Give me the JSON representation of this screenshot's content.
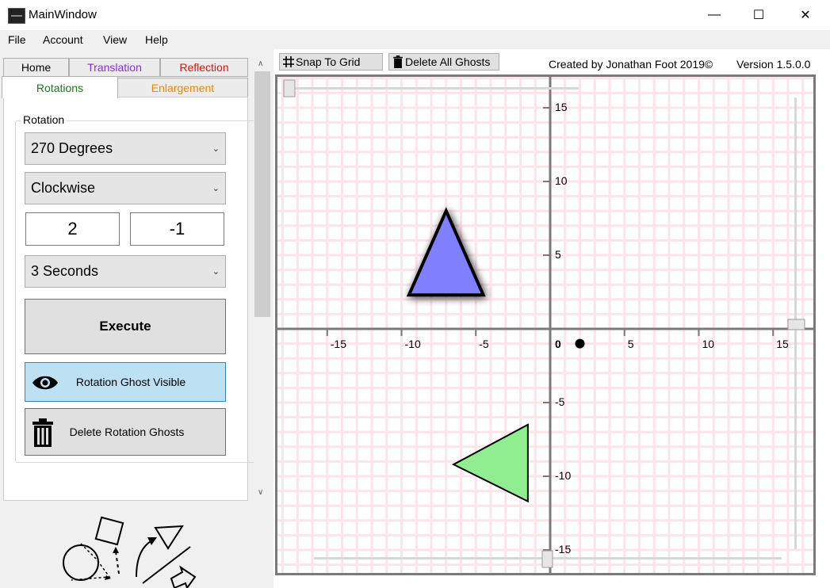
{
  "window": {
    "title": "MainWindow",
    "minimize_glyph": "—",
    "maximize_glyph": "☐",
    "close_glyph": "✕"
  },
  "menu": {
    "items": [
      "File",
      "Account",
      "View",
      "Help"
    ]
  },
  "tabs": {
    "home": {
      "label": "Home",
      "color": "#000000"
    },
    "translation": {
      "label": "Translation",
      "color": "#8a2be2"
    },
    "reflection": {
      "label": "Reflection",
      "color": "#e01010"
    },
    "rotations": {
      "label": "Rotations",
      "color": "#1a7a1a"
    },
    "enlargement": {
      "label": "Enlargement",
      "color": "#e88a00"
    }
  },
  "rotation": {
    "group_label": "Rotation",
    "angle": "270 Degrees",
    "direction": "Clockwise",
    "centre_x": "2",
    "centre_y": "-1",
    "duration": "3 Seconds",
    "execute_label": "Execute",
    "ghost_visible_label": "Rotation Ghost Visible",
    "delete_ghosts_label": "Delete Rotation Ghosts",
    "ghost_icon": "eye-icon",
    "delete_icon": "trash-icon"
  },
  "toolbar": {
    "snap_label": "Snap To Grid",
    "delete_all_label": "Delete All Ghosts",
    "snap_icon": "grid-icon",
    "delete_icon": "trash-icon",
    "credit": "Created by Jonathan Foot 2019©",
    "version": "Version 1.5.0.0"
  },
  "graph": {
    "x_range": [
      -18,
      18
    ],
    "y_range": [
      -16,
      17.5
    ],
    "x_ticks": [
      "-15",
      "-10",
      "-5",
      "0",
      "5",
      "10",
      "15"
    ],
    "y_ticks": [
      "15",
      "10",
      "5",
      "-5",
      "-10",
      "-15"
    ],
    "grid_color": "#fbe4ea",
    "rotation_centre": [
      2,
      -1
    ],
    "shapes": [
      {
        "name": "blue-triangle",
        "points": [
          [
            -7,
            8
          ],
          [
            -9.5,
            2.3
          ],
          [
            -4.5,
            2.3
          ]
        ],
        "fill": "#8080ff"
      },
      {
        "name": "green-triangle",
        "points": [
          [
            -1.5,
            -6.5
          ],
          [
            -6.5,
            -9.2
          ],
          [
            -1.5,
            -11.7
          ]
        ],
        "fill": "#90ee90"
      }
    ]
  }
}
